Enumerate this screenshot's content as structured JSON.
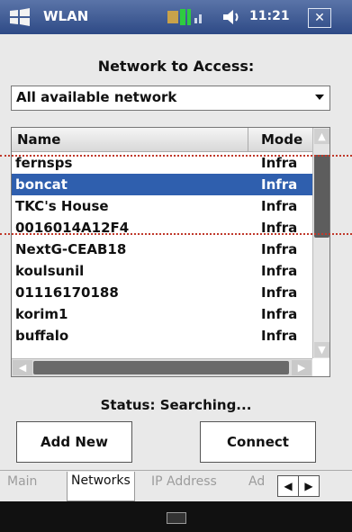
{
  "statusbar": {
    "app_title": "WLAN",
    "clock": "11:21",
    "close_glyph": "✕",
    "icons": [
      "windows-logo-icon",
      "signal-icon",
      "volume-icon"
    ]
  },
  "main": {
    "heading": "Network to Access:",
    "dropdown_value": "All available network",
    "columns": {
      "name": "Name",
      "mode": "Mode"
    },
    "rows": [
      {
        "name": "fernsps",
        "mode": "Infra"
      },
      {
        "name": "boncat",
        "mode": "Infra",
        "selected": true
      },
      {
        "name": "TKC's House",
        "mode": "Infra"
      },
      {
        "name": "0016014A12F4",
        "mode": "Infra"
      },
      {
        "name": "NextG-CEAB18",
        "mode": "Infra"
      },
      {
        "name": "koulsunil",
        "mode": "Infra"
      },
      {
        "name": "01116170188",
        "mode": "Infra"
      },
      {
        "name": "korim1",
        "mode": "Infra"
      },
      {
        "name": "buffalo",
        "mode": "Infra"
      }
    ],
    "status": "Status: Searching...",
    "add_new_label": "Add New",
    "connect_label": "Connect"
  },
  "tabs": [
    {
      "label": "Main",
      "active": false
    },
    {
      "label": "Networks",
      "active": true
    },
    {
      "label": "IP Address",
      "active": false
    },
    {
      "label": "Ad",
      "active": false
    }
  ],
  "colors": {
    "selection": "#2f5fae",
    "statusbar": "#2e4a86",
    "annotation_dotted": "#c0392b"
  }
}
